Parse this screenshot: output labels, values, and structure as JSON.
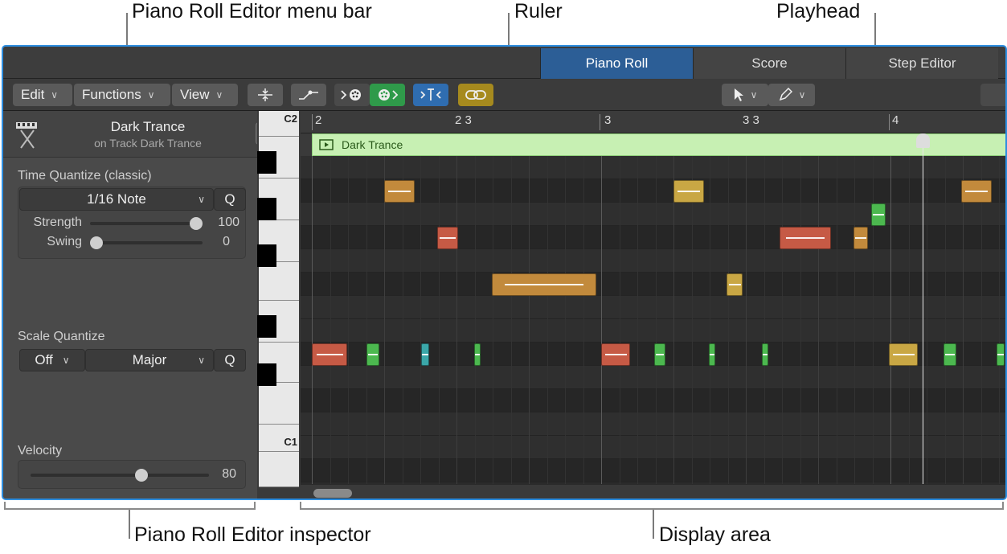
{
  "callouts": {
    "menu_bar": "Piano Roll Editor menu bar",
    "ruler": "Ruler",
    "playhead": "Playhead",
    "inspector": "Piano Roll Editor inspector",
    "display_area": "Display area"
  },
  "tabs": [
    {
      "label": "Piano Roll",
      "active": true
    },
    {
      "label": "Score",
      "active": false
    },
    {
      "label": "Step Editor",
      "active": false
    }
  ],
  "toolbar": {
    "menus": [
      "Edit",
      "Functions",
      "View"
    ]
  },
  "inspector": {
    "region_name": "Dark Trance",
    "track_info": "on Track Dark Trance",
    "time_quantize": {
      "title": "Time Quantize (classic)",
      "value": "1/16 Note",
      "q_label": "Q",
      "strength_label": "Strength",
      "strength_value": "100",
      "strength_level": 1.0,
      "swing_label": "Swing",
      "swing_value": "0",
      "swing_level": 0.0
    },
    "scale_quantize": {
      "title": "Scale Quantize",
      "root": "Off",
      "scale": "Major",
      "q_label": "Q"
    },
    "velocity": {
      "title": "Velocity",
      "value": "80",
      "level": 0.63
    }
  },
  "keyboard": {
    "labels": [
      "C2",
      "C1"
    ]
  },
  "ruler": {
    "marks": [
      "2",
      "2 3",
      "3",
      "3 3",
      "4"
    ]
  },
  "region": {
    "name": "Dark Trance",
    "color": "#c7f0b3"
  },
  "colors": {
    "accent": "#2c5e96",
    "note_orange": "#c28a3c",
    "note_yellow": "#c9a744",
    "note_red": "#c65a45",
    "note_green": "#4cb84f",
    "note_teal": "#3ba7a9"
  }
}
